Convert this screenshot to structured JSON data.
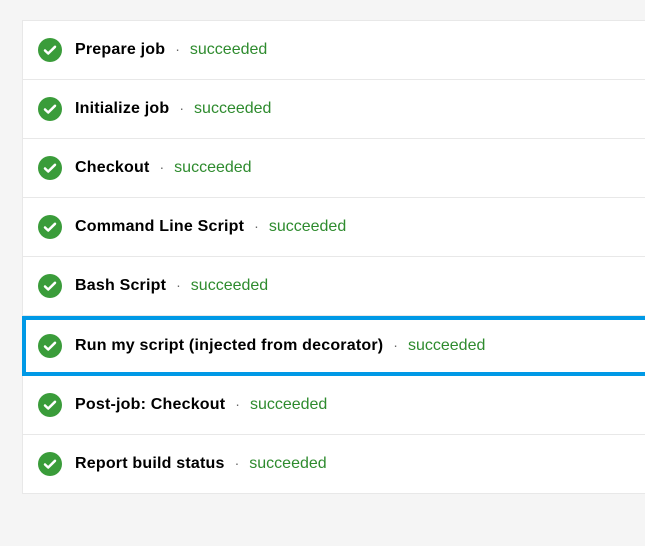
{
  "steps": [
    {
      "name": "Prepare job",
      "status": "succeeded",
      "highlighted": false
    },
    {
      "name": "Initialize job",
      "status": "succeeded",
      "highlighted": false
    },
    {
      "name": "Checkout",
      "status": "succeeded",
      "highlighted": false
    },
    {
      "name": "Command Line Script",
      "status": "succeeded",
      "highlighted": false
    },
    {
      "name": "Bash Script",
      "status": "succeeded",
      "highlighted": false
    },
    {
      "name": "Run my script (injected from decorator)",
      "status": "succeeded",
      "highlighted": true
    },
    {
      "name": "Post-job: Checkout",
      "status": "succeeded",
      "highlighted": false
    },
    {
      "name": "Report build status",
      "status": "succeeded",
      "highlighted": false
    }
  ],
  "separator": "·",
  "colors": {
    "success": "#3a9c3a",
    "highlight": "#0099e6"
  }
}
